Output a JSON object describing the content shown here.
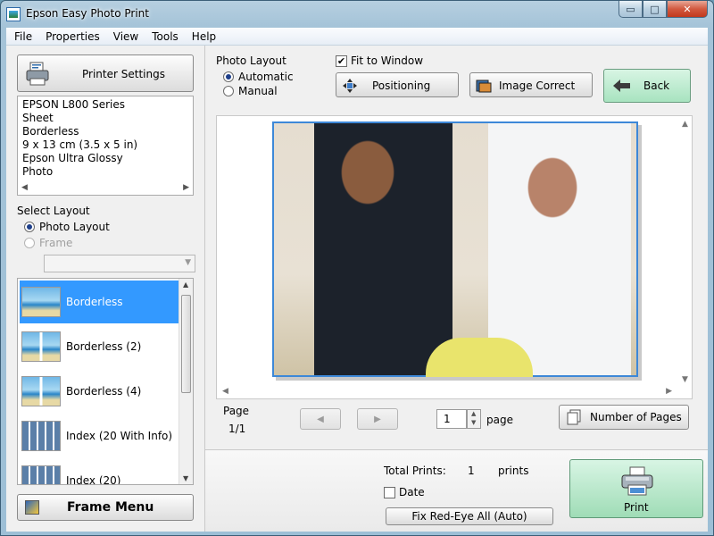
{
  "window": {
    "title": "Epson Easy Photo Print"
  },
  "window_controls": {
    "minimize": "▭",
    "maximize": "□",
    "close": "✕"
  },
  "menu": [
    "File",
    "Properties",
    "View",
    "Tools",
    "Help"
  ],
  "printer": {
    "button_label": "Printer Settings",
    "info_lines": [
      "EPSON L800 Series",
      "Sheet",
      "Borderless",
      "9 x 13 cm (3.5 x 5 in)",
      "Epson Ultra Glossy",
      "Photo"
    ]
  },
  "select_layout": {
    "heading": "Select Layout",
    "options": [
      {
        "label": "Photo Layout",
        "checked": true,
        "enabled": true
      },
      {
        "label": "Frame",
        "checked": false,
        "enabled": false
      }
    ],
    "items": [
      {
        "label": "Borderless",
        "thumb": "beach",
        "selected": true
      },
      {
        "label": "Borderless (2)",
        "thumb": "multi",
        "selected": false
      },
      {
        "label": "Borderless (4)",
        "thumb": "multi",
        "selected": false
      },
      {
        "label": "Index (20 With Info)",
        "thumb": "index",
        "selected": false
      },
      {
        "label": "Index (20)",
        "thumb": "index",
        "selected": false
      }
    ]
  },
  "frame_menu": {
    "label": "Frame Menu"
  },
  "photo_layout": {
    "heading": "Photo Layout",
    "options": [
      {
        "label": "Automatic",
        "checked": true
      },
      {
        "label": "Manual",
        "checked": false
      }
    ]
  },
  "fit_to_window": {
    "label": "Fit to Window",
    "checked": true
  },
  "toolbar": {
    "positioning": "Positioning",
    "image_correct": "Image Correct",
    "back": "Back"
  },
  "page": {
    "label": "Page",
    "counter": "1/1",
    "current": "1",
    "unit": "page",
    "number_of_pages": "Number of Pages"
  },
  "totals": {
    "label": "Total Prints:",
    "value": "1",
    "unit": "prints",
    "date_label": "Date",
    "date_checked": false,
    "redeye_label": "Fix Red-Eye All (Auto)",
    "print_label": "Print"
  },
  "colors": {
    "selection": "#3399ff",
    "green_button": "#a8e3c0",
    "photo_border": "#3d88d8"
  }
}
